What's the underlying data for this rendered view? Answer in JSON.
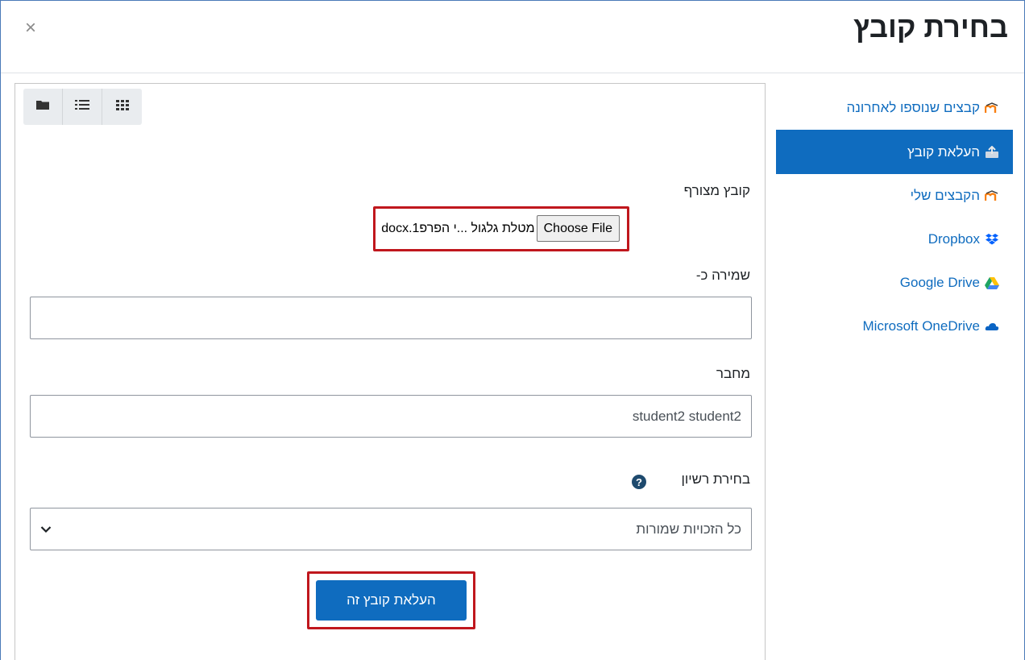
{
  "dialog": {
    "title": "בחירת קובץ",
    "close_symbol": "×"
  },
  "sidebar": {
    "items": [
      {
        "label": "קבצים שנוספו לאחרונה",
        "icon": "moodle-icon",
        "active": false
      },
      {
        "label": "העלאת קובץ",
        "icon": "upload-icon",
        "active": true
      },
      {
        "label": "הקבצים שלי",
        "icon": "moodle-icon",
        "active": false
      },
      {
        "label": "Dropbox",
        "icon": "dropbox-icon",
        "active": false
      },
      {
        "label": "Google Drive",
        "icon": "google-drive-icon",
        "active": false
      },
      {
        "label": "Microsoft OneDrive",
        "icon": "onedrive-icon",
        "active": false
      }
    ]
  },
  "viewbar": {
    "views": [
      "folder-view",
      "list-view",
      "grid-view"
    ]
  },
  "form": {
    "attachment_label": "קובץ מצורף",
    "choose_file_label": "Choose File",
    "file_name": "מטלת גלגול ...י הפרפ1.docx",
    "save_as_label": "שמירה כ-",
    "save_as_value": "",
    "author_label": "מחבר",
    "author_value": "student2 student2",
    "license_label": "בחירת רשיון",
    "license_value": "כל הזכויות שמורות",
    "submit_label": "העלאת קובץ זה"
  },
  "colors": {
    "accent": "#0f6cbf",
    "highlight": "#c0171d"
  }
}
